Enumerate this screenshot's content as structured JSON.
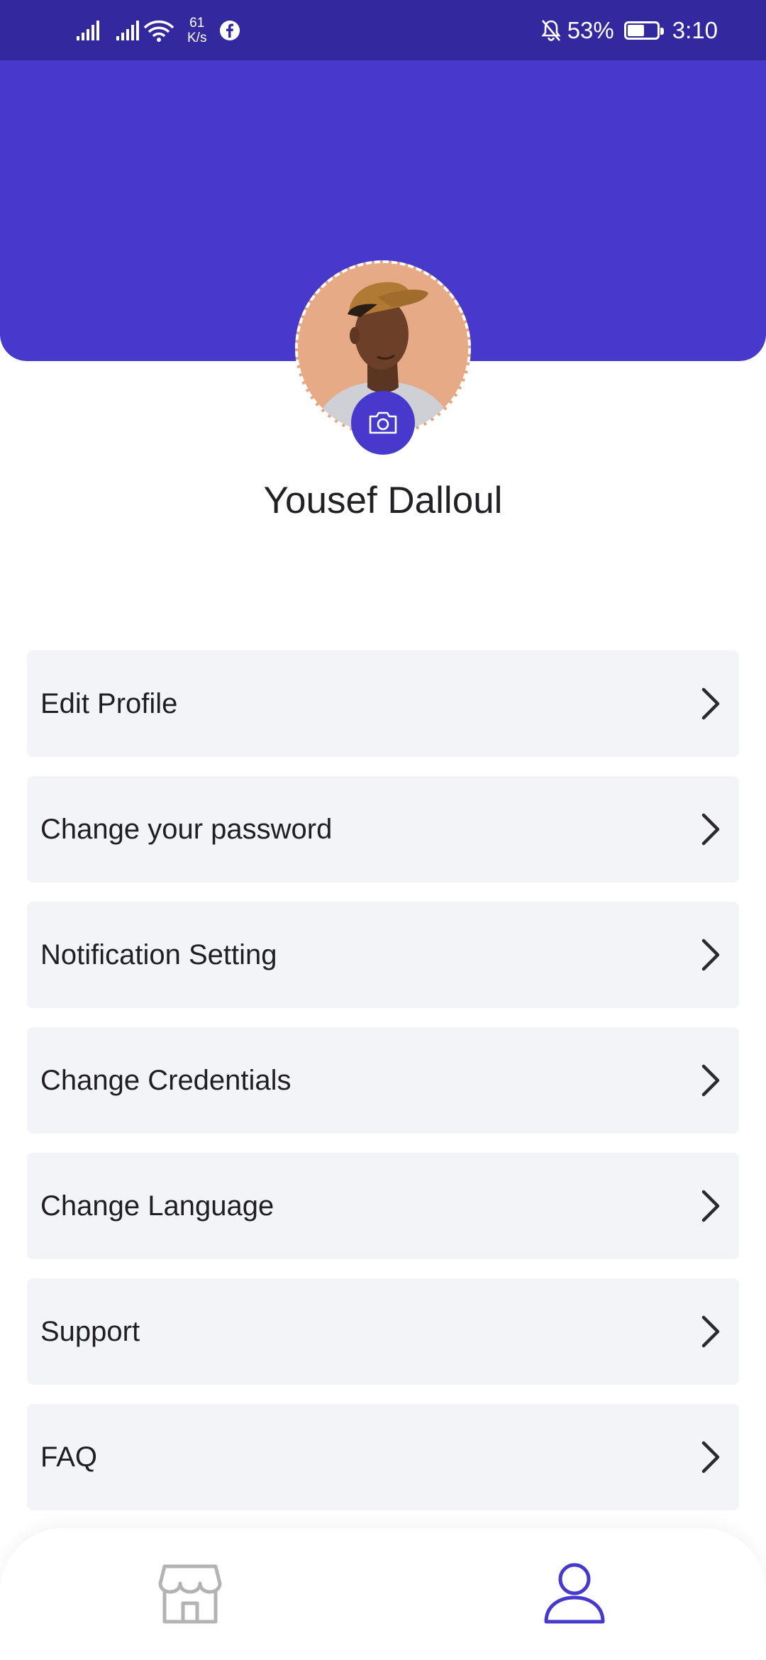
{
  "status_bar": {
    "net_speed_value": "61",
    "net_speed_unit": "K/s",
    "battery_percent": "53%",
    "time": "3:10",
    "icons": [
      "signal-icon",
      "signal-icon",
      "wifi-icon",
      "facebook-icon",
      "mute-bell-icon",
      "battery-icon"
    ]
  },
  "profile": {
    "name": "Yousef Dalloul",
    "avatar_icon": "profile-photo",
    "camera_icon": "camera-icon"
  },
  "menu": {
    "items": [
      {
        "label": "Edit Profile"
      },
      {
        "label": "Change your password"
      },
      {
        "label": "Notification Setting"
      },
      {
        "label": "Change Credentials"
      },
      {
        "label": "Change Language"
      },
      {
        "label": "Support"
      },
      {
        "label": "FAQ"
      }
    ]
  },
  "bottom_nav": {
    "items": [
      {
        "icon": "store-icon",
        "active": false
      },
      {
        "icon": "user-icon",
        "active": true
      }
    ]
  },
  "colors": {
    "primary": "#4639cc",
    "status_bar": "#33299f",
    "menu_item_bg": "#f3f4f8",
    "nav_inactive": "#b3b3b3"
  }
}
